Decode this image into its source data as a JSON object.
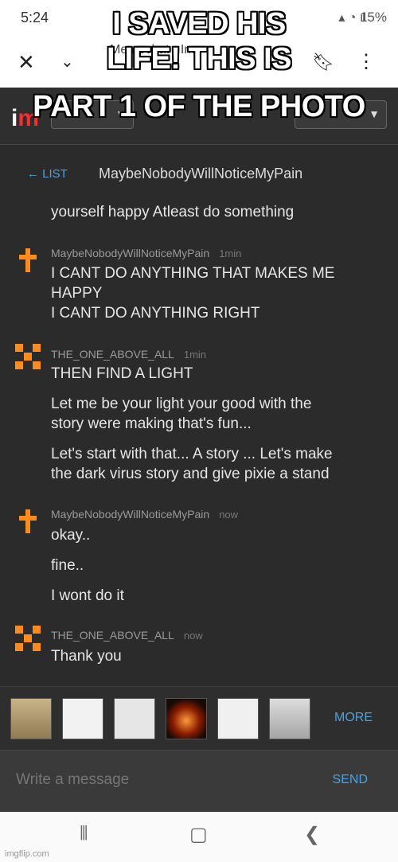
{
  "meme": {
    "caption": [
      "I SAVED HIS",
      "LIFE! THIS IS",
      "PART 1 OF THE PHOTO"
    ]
  },
  "status": {
    "time": "5:24",
    "battery": "15%"
  },
  "browser": {
    "title": "Memechat - Im"
  },
  "app": {
    "logo_i": "i",
    "logo_m": "m"
  },
  "chat": {
    "back_label": "← LIST",
    "name": "MaybeNobodyWillNoticeMyPain",
    "partial_top": "yourself happy Atleast do something",
    "groups": [
      {
        "author": "MaybeNobodyWillNoticeMyPain",
        "time": "1min",
        "lines": [
          "I CANT DO ANYTHING THAT MAKES ME",
          "HAPPY",
          "I CANT DO ANYTHING RIGHT"
        ]
      },
      {
        "author": "THE_ONE_ABOVE_ALL",
        "time": "1min",
        "lines": [
          "THEN FIND A LIGHT",
          "Let me be your light your good with the",
          "story were making that's fun...",
          "Let's start with that... A story ... Let's make",
          "the dark virus story and give pixie a stand"
        ]
      },
      {
        "author": "MaybeNobodyWillNoticeMyPain",
        "time": "now",
        "lines": [
          "okay..",
          "fine..",
          "I wont do it"
        ]
      },
      {
        "author": "THE_ONE_ABOVE_ALL",
        "time": "now",
        "lines": [
          "Thank you"
        ]
      }
    ]
  },
  "memebar": {
    "more_label": "MORE"
  },
  "composer": {
    "placeholder": "Write a message",
    "send_label": "SEND"
  },
  "footer": {
    "watermark": "imgflip.com"
  },
  "colors": {
    "accent": "#4aa3df",
    "avatar": "#ff8c1a"
  }
}
